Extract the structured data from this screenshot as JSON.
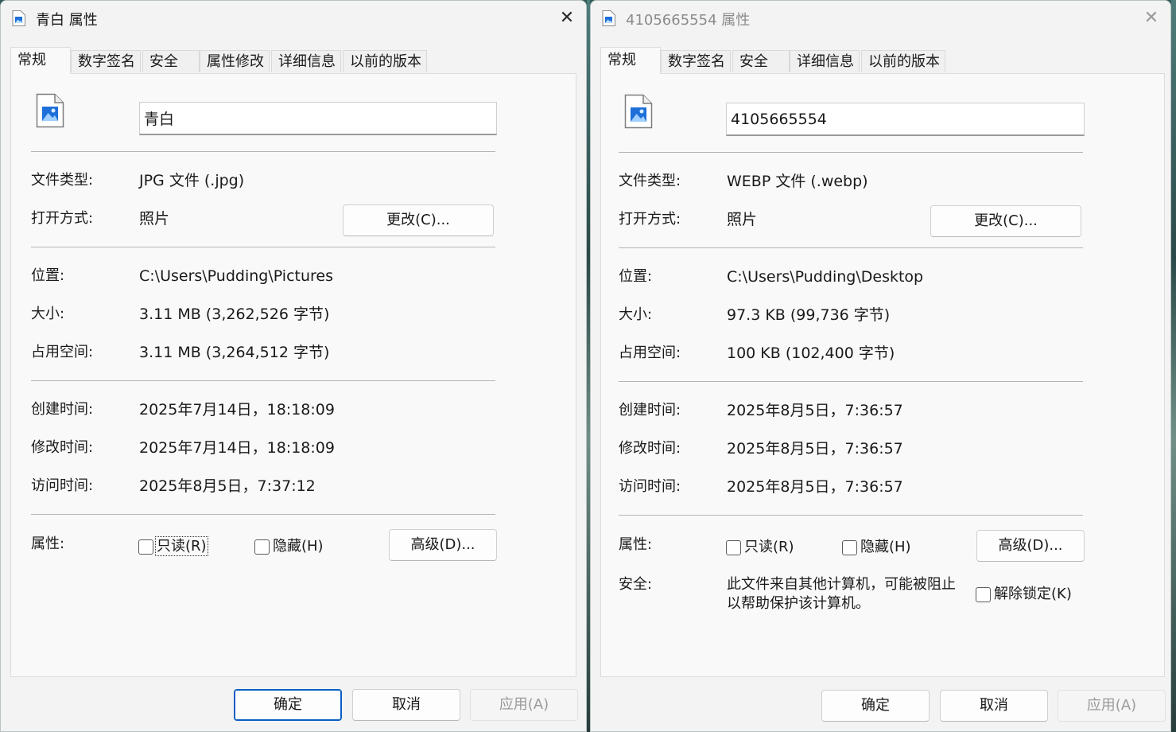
{
  "left_dialog": {
    "title": "青白 属性",
    "close_glyph": "✕",
    "tabs": [
      {
        "label": "常规",
        "active": true
      },
      {
        "label": "数字签名"
      },
      {
        "label": "安全"
      },
      {
        "label": "属性修改"
      },
      {
        "label": "详细信息"
      },
      {
        "label": "以前的版本"
      }
    ],
    "file_name": "青白",
    "file_type_label": "文件类型:",
    "file_type": "JPG 文件 (.jpg)",
    "open_with_label": "打开方式:",
    "open_with": "照片",
    "change_button": "更改(C)...",
    "location_label": "位置:",
    "location": "C:\\Users\\Pudding\\Pictures",
    "size_label": "大小:",
    "size": "3.11 MB (3,262,526 字节)",
    "size_on_disk_label": "占用空间:",
    "size_on_disk": "3.11 MB (3,264,512 字节)",
    "created_label": "创建时间:",
    "created": "2025年7月14日，18:18:09",
    "modified_label": "修改时间:",
    "modified": "2025年7月14日，18:18:09",
    "accessed_label": "访问时间:",
    "accessed": "2025年8月5日，7:37:12",
    "attributes_label": "属性:",
    "readonly_label": "只读(R)",
    "hidden_label": "隐藏(H)",
    "advanced_button": "高级(D)...",
    "ok_button": "确定",
    "cancel_button": "取消",
    "apply_button": "应用(A)"
  },
  "right_dialog": {
    "title": "4105665554 属性",
    "close_glyph": "✕",
    "tabs": [
      {
        "label": "常规",
        "active": true
      },
      {
        "label": "数字签名"
      },
      {
        "label": "安全"
      },
      {
        "label": "详细信息"
      },
      {
        "label": "以前的版本"
      }
    ],
    "file_name": "4105665554",
    "file_type_label": "文件类型:",
    "file_type": "WEBP 文件 (.webp)",
    "open_with_label": "打开方式:",
    "open_with": "照片",
    "change_button": "更改(C)...",
    "location_label": "位置:",
    "location": "C:\\Users\\Pudding\\Desktop",
    "size_label": "大小:",
    "size": "97.3 KB (99,736 字节)",
    "size_on_disk_label": "占用空间:",
    "size_on_disk": "100 KB (102,400 字节)",
    "created_label": "创建时间:",
    "created": "2025年8月5日，7:36:57",
    "modified_label": "修改时间:",
    "modified": "2025年8月5日，7:36:57",
    "accessed_label": "访问时间:",
    "accessed": "2025年8月5日，7:36:57",
    "attributes_label": "属性:",
    "readonly_label": "只读(R)",
    "hidden_label": "隐藏(H)",
    "advanced_button": "高级(D)...",
    "security_label": "安全:",
    "security_line1": "此文件来自其他计算机，可能被阻止",
    "security_line2": "以帮助保护该计算机。",
    "unblock_label": "解除锁定(K)",
    "ok_button": "确定",
    "cancel_button": "取消",
    "apply_button": "应用(A)"
  },
  "colors": {
    "window_bg": "#f3f3f3",
    "panel_bg": "#f9f9f9",
    "primary_border": "#0a5fc2",
    "icon_blue": "#1e6fd9"
  },
  "icons": [
    "image-file-icon",
    "close-icon"
  ]
}
